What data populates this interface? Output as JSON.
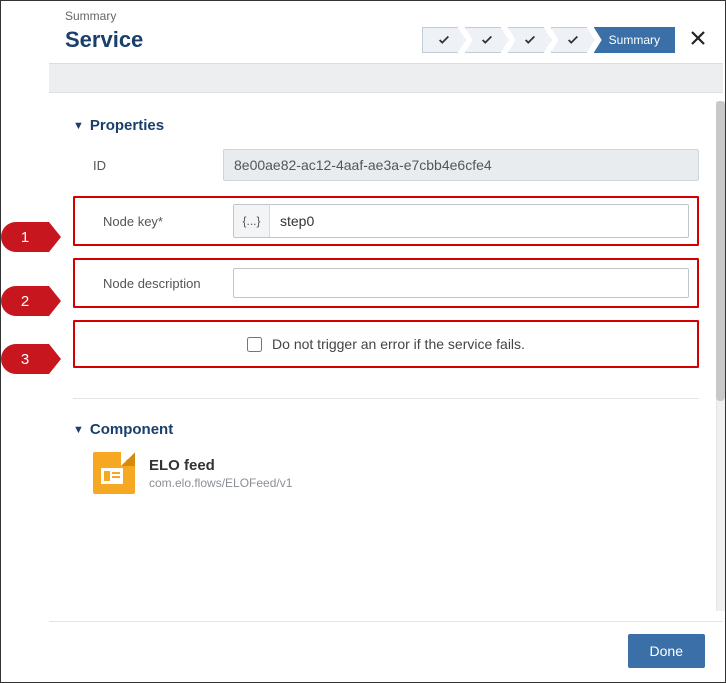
{
  "breadcrumb": "Summary",
  "title": "Service",
  "steps": {
    "active_label": "Summary"
  },
  "properties": {
    "section_title": "Properties",
    "id_label": "ID",
    "id_value": "8e00ae82-ac12-4aaf-ae3a-e7cbb4e6cfe4",
    "node_key_label": "Node key*",
    "node_key_prefix": "{...}",
    "node_key_value": "step0",
    "node_desc_label": "Node description",
    "node_desc_value": "",
    "error_checkbox_label": "Do not trigger an error if the service fails."
  },
  "component": {
    "section_title": "Component",
    "name": "ELO feed",
    "path": "com.elo.flows/ELOFeed/v1"
  },
  "footer": {
    "done_label": "Done"
  },
  "callouts": [
    "1",
    "2",
    "3"
  ]
}
